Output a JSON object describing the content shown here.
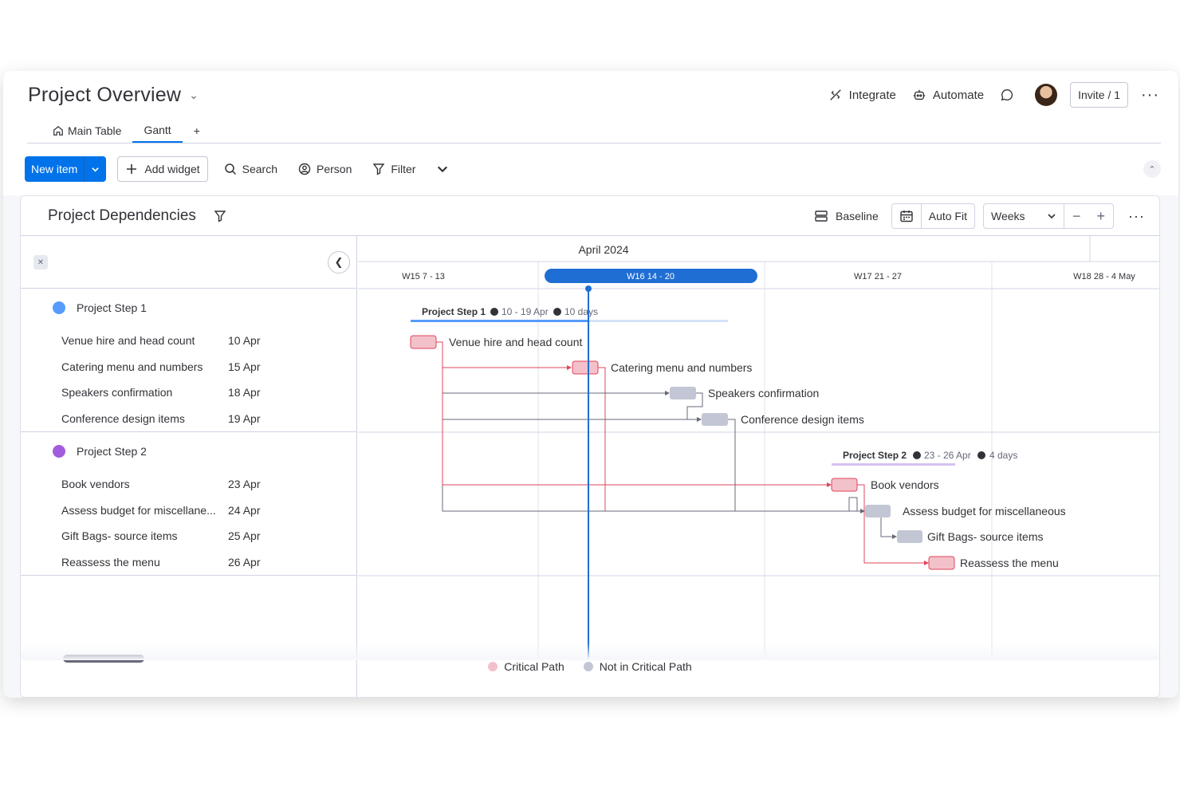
{
  "header": {
    "title": "Project Overview",
    "actions": {
      "integrate": "Integrate",
      "automate": "Automate",
      "invite": "Invite / 1"
    }
  },
  "tabs": [
    {
      "label": "Main Table"
    },
    {
      "label": "Gantt"
    },
    {
      "label": "+"
    }
  ],
  "toolbar": {
    "new_item": "New item",
    "add_widget": "Add widget",
    "search": "Search",
    "person": "Person",
    "filter": "Filter"
  },
  "widget": {
    "title": "Project Dependencies",
    "baseline": "Baseline",
    "auto_fit": "Auto Fit",
    "scale": "Weeks"
  },
  "timeline": {
    "month": "April 2024",
    "weeks": [
      "W15 7 - 13",
      "W16 14 - 20",
      "W17 21 - 27",
      "W18 28 - 4 May"
    ],
    "current_week_index": 1
  },
  "groups": [
    {
      "name": "Project Step 1",
      "color": "#579bfc",
      "summary": {
        "name": "Project Step 1",
        "range": "10 - 19 Apr",
        "duration": "10 days"
      },
      "items": [
        {
          "name": "Venue hire and head count",
          "date": "10 Apr",
          "critical": true
        },
        {
          "name": "Catering menu and numbers",
          "date": "15 Apr",
          "critical": true
        },
        {
          "name": "Speakers confirmation",
          "date": "18 Apr",
          "critical": false
        },
        {
          "name": "Conference design items",
          "date": "19 Apr",
          "critical": false
        }
      ]
    },
    {
      "name": "Project Step 2",
      "color": "#a25ddc",
      "summary": {
        "name": "Project Step 2",
        "range": "23 - 26 Apr",
        "duration": "4 days"
      },
      "items": [
        {
          "name": "Book vendors",
          "date": "23 Apr",
          "critical": true
        },
        {
          "name": "Assess budget for miscellane...",
          "date": "24 Apr",
          "critical": false
        },
        {
          "name": "Gift Bags- source items",
          "date": "25 Apr",
          "critical": false
        },
        {
          "name": "Reassess the menu",
          "date": "26 Apr",
          "critical": true
        }
      ]
    }
  ],
  "gantt_labels": [
    "Venue hire and head count",
    "Catering menu and numbers",
    "Speakers confirmation",
    "Conference design items",
    "Book vendors",
    "Assess budget for miscellaneous",
    "Gift Bags- source items",
    "Reassess the menu"
  ],
  "legend": {
    "critical": "Critical Path",
    "not_critical": "Not in Critical Path"
  },
  "colors": {
    "accent": "#0073ea",
    "today_line": "#1f6ed4",
    "critical_fill": "#f3c1c9",
    "critical_stroke": "#e2445c",
    "normal_fill": "#c3c6d4",
    "normal_line": "#676879"
  }
}
